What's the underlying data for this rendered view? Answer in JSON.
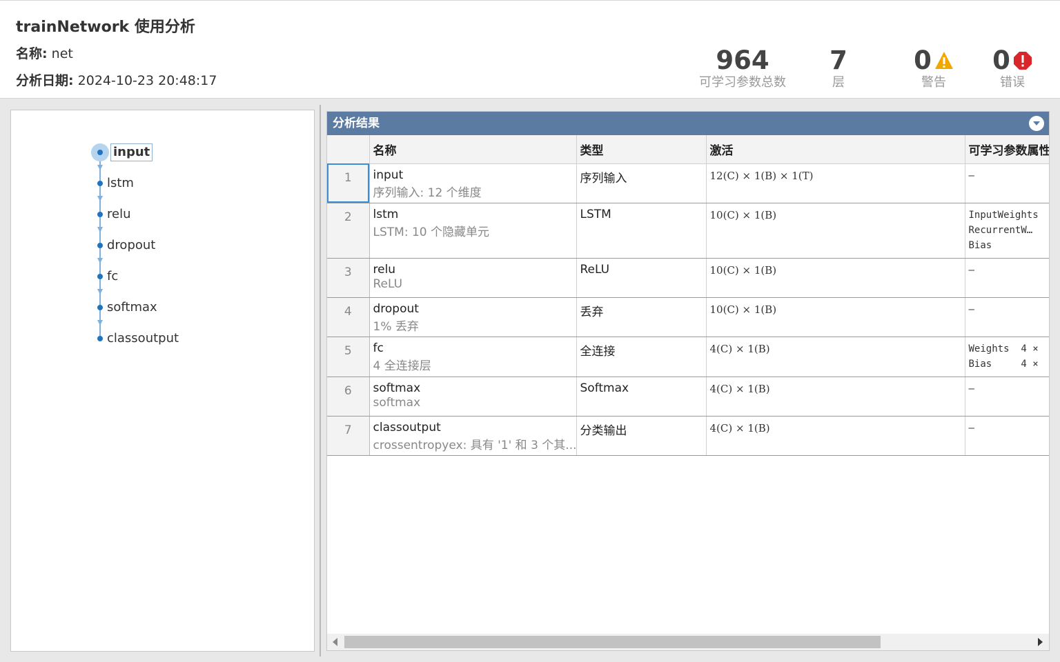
{
  "header": {
    "title": "trainNetwork 使用分析",
    "name_label": "名称:",
    "name_value": "net",
    "date_label": "分析日期:",
    "date_value": "2024-10-23 20:48:17"
  },
  "stats": {
    "params_value": "964",
    "params_label": "可学习参数总数",
    "layers_value": "7",
    "layers_label": "层",
    "warnings_value": "0",
    "warnings_label": "警告",
    "errors_value": "0",
    "errors_label": "错误",
    "warning_color": "#f0a800",
    "error_color": "#d9262b"
  },
  "graph": {
    "nodes": [
      "input",
      "lstm",
      "relu",
      "dropout",
      "fc",
      "softmax",
      "classoutput"
    ],
    "selected": "input",
    "node_color": "#1f74c2"
  },
  "results": {
    "title": "分析结果",
    "columns": [
      "",
      "名称",
      "类型",
      "激活",
      "可学习参数属性"
    ],
    "rows": [
      {
        "index": "1",
        "name": "input",
        "desc": "序列输入: 12 个维度",
        "type": "序列输入",
        "activation": "12(C) × 1(B) × 1(T)",
        "params": "–"
      },
      {
        "index": "2",
        "name": "lstm",
        "desc": "LSTM: 10 个隐藏单元",
        "type": "LSTM",
        "activation": "10(C) × 1(B)",
        "params": "InputWeights\nRecurrentW…\nBias"
      },
      {
        "index": "3",
        "name": "relu",
        "desc": "ReLU",
        "type": "ReLU",
        "activation": "10(C) × 1(B)",
        "params": "–"
      },
      {
        "index": "4",
        "name": "dropout",
        "desc": "1% 丢弃",
        "type": "丢弃",
        "activation": "10(C) × 1(B)",
        "params": "–"
      },
      {
        "index": "5",
        "name": "fc",
        "desc": "4 全连接层",
        "type": "全连接",
        "activation": "4(C) × 1(B)",
        "params": "Weights  4 ×\nBias     4 ×"
      },
      {
        "index": "6",
        "name": "softmax",
        "desc": "softmax",
        "type": "Softmax",
        "activation": "4(C) × 1(B)",
        "params": "–"
      },
      {
        "index": "7",
        "name": "classoutput",
        "desc": "crossentropyex: 具有 '1' 和 3 个其...",
        "type": "分类输出",
        "activation": "4(C) × 1(B)",
        "params": "–"
      }
    ]
  }
}
